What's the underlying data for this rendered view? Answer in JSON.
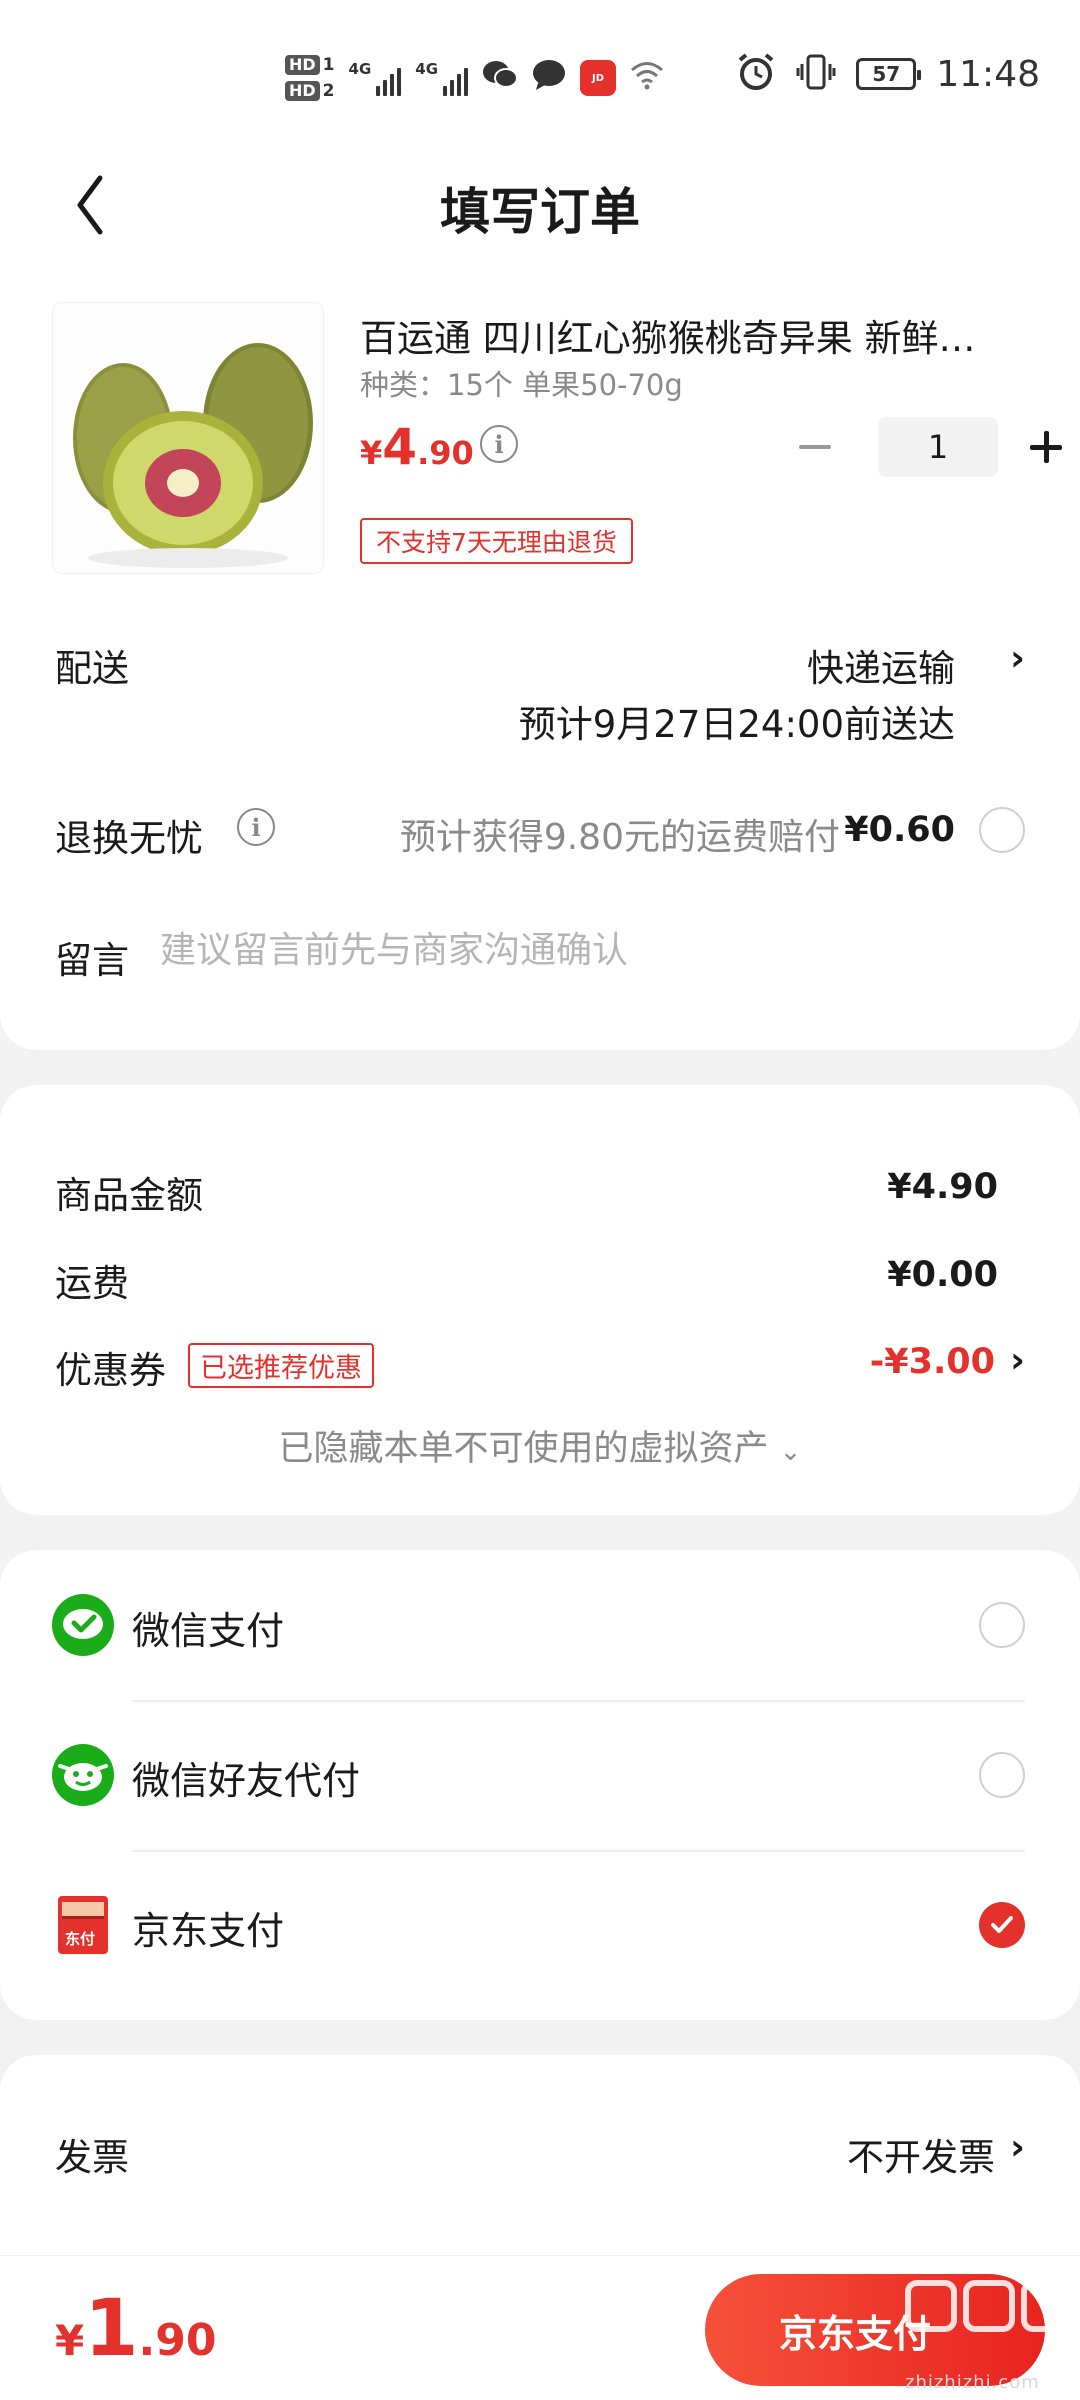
{
  "status_bar": {
    "sim1": "HD",
    "sim1_num": "1",
    "sim2": "HD",
    "sim2_num": "2",
    "network": "4G",
    "battery": "57",
    "time": "11:48"
  },
  "header": {
    "title": "填写订单"
  },
  "product": {
    "title": "百运通 四川红心猕猴桃奇异果 新鲜水果",
    "spec": "种类：15个 单果50-70g",
    "price_currency": "¥",
    "price_int": "4",
    "price_dec": ".90",
    "quantity": "1",
    "return_tag": "不支持7天无理由退货"
  },
  "delivery": {
    "label": "配送",
    "method": "快递运输",
    "eta": "预计9月27日24:00前送达"
  },
  "refund_insurance": {
    "label": "退换无忧",
    "text": "预计获得9.80元的运费赔付",
    "price": "¥0.60"
  },
  "note": {
    "label": "留言",
    "placeholder": "建议留言前先与商家沟通确认"
  },
  "summary": {
    "goods_label": "商品金额",
    "goods_value": "¥4.90",
    "shipping_label": "运费",
    "shipping_value": "¥0.00",
    "coupon_label": "优惠券",
    "coupon_tag": "已选推荐优惠",
    "coupon_value": "-¥3.00",
    "hidden_assets": "已隐藏本单不可使用的虚拟资产"
  },
  "payment": {
    "methods": [
      {
        "label": "微信支付",
        "icon": "wechat-pay-icon",
        "selected": false
      },
      {
        "label": "微信好友代付",
        "icon": "wechat-friend-pay-icon",
        "selected": false
      },
      {
        "label": "京东支付",
        "icon": "jd-pay-icon",
        "selected": true
      }
    ],
    "jd_icon_text": "东付"
  },
  "invoice": {
    "label": "发票",
    "value": "不开发票"
  },
  "footer": {
    "currency": "¥",
    "total_int": "1",
    "total_dec": ".90",
    "pay_button": "京东支付",
    "watermark": "zhizhizhi.com"
  },
  "colors": {
    "accent": "#e4312b",
    "wechat_green": "#1aad19"
  }
}
